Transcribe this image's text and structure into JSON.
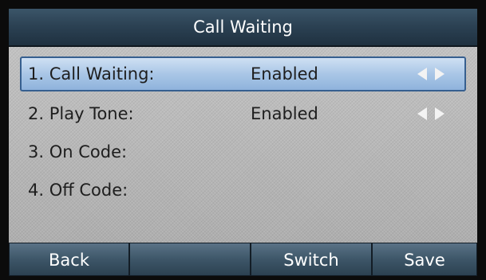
{
  "screen": {
    "title": "Call Waiting"
  },
  "rows": [
    {
      "label": "1. Call Waiting:",
      "value": "Enabled",
      "selected": true,
      "has_arrows": true
    },
    {
      "label": "2. Play Tone:",
      "value": "Enabled",
      "selected": false,
      "has_arrows": true
    },
    {
      "label": "3. On Code:",
      "value": "",
      "selected": false,
      "has_arrows": false
    },
    {
      "label": "4. Off Code:",
      "value": "",
      "selected": false,
      "has_arrows": false
    }
  ],
  "softkeys": [
    {
      "label": "Back"
    },
    {
      "label": ""
    },
    {
      "label": "Switch"
    },
    {
      "label": "Save"
    }
  ],
  "colors": {
    "header": "#2c4254",
    "selection": "#a9c6e6",
    "selection_border": "#365f8f",
    "softkey": "#3d5668",
    "content_bg": "#b8b8b8"
  },
  "icons": {
    "left_arrow": "triangle-left",
    "right_arrow": "triangle-right"
  }
}
